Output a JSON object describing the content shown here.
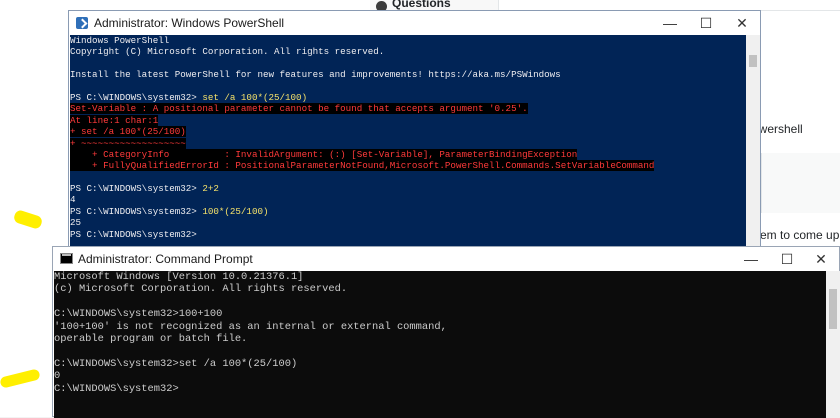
{
  "background": {
    "tab_label": "Questions",
    "right_text_1": "owershell",
    "right_text_2": "em to come up"
  },
  "powershell": {
    "title": "Administrator: Windows PowerShell",
    "controls": {
      "minimize": "—",
      "maximize": "☐",
      "close": "✕"
    },
    "lines": [
      {
        "prompt": "",
        "text": "Windows PowerShell",
        "kind": "normal"
      },
      {
        "prompt": "",
        "text": "Copyright (C) Microsoft Corporation. All rights reserved.",
        "kind": "normal"
      },
      {
        "prompt": "",
        "text": "",
        "kind": "normal"
      },
      {
        "prompt": "",
        "text": "Install the latest PowerShell for new features and improvements! https://aka.ms/PSWindows",
        "kind": "normal"
      },
      {
        "prompt": "",
        "text": "",
        "kind": "normal"
      },
      {
        "prompt": "PS C:\\WINDOWS\\system32> ",
        "text": "set /a 100*(25/100)",
        "kind": "cmd"
      },
      {
        "prompt": "",
        "text": "Set-Variable : A positional parameter cannot be found that accepts argument '0.25'.",
        "kind": "error"
      },
      {
        "prompt": "",
        "text": "At line:1 char:1",
        "kind": "error"
      },
      {
        "prompt": "",
        "text": "+ set /a 100*(25/100)",
        "kind": "error"
      },
      {
        "prompt": "",
        "text": "+ ~~~~~~~~~~~~~~~~~~~",
        "kind": "error"
      },
      {
        "prompt": "",
        "text": "    + CategoryInfo          : InvalidArgument: (:) [Set-Variable], ParameterBindingException",
        "kind": "error"
      },
      {
        "prompt": "",
        "text": "    + FullyQualifiedErrorId : PositionalParameterNotFound,Microsoft.PowerShell.Commands.SetVariableCommand",
        "kind": "error"
      },
      {
        "prompt": "",
        "text": "",
        "kind": "normal"
      },
      {
        "prompt": "PS C:\\WINDOWS\\system32> ",
        "text": "2+2",
        "kind": "cmd"
      },
      {
        "prompt": "",
        "text": "4",
        "kind": "normal"
      },
      {
        "prompt": "PS C:\\WINDOWS\\system32> ",
        "text": "100*(25/100)",
        "kind": "cmd"
      },
      {
        "prompt": "",
        "text": "25",
        "kind": "normal"
      },
      {
        "prompt": "PS C:\\WINDOWS\\system32>",
        "text": "",
        "kind": "cmd"
      }
    ]
  },
  "cmd": {
    "title": "Administrator: Command Prompt",
    "controls": {
      "minimize": "—",
      "maximize": "☐",
      "close": "✕"
    },
    "lines": [
      "Microsoft Windows [Version 10.0.21376.1]",
      "(c) Microsoft Corporation. All rights reserved.",
      "",
      "C:\\WINDOWS\\system32>100+100",
      "'100+100' is not recognized as an internal or external command,",
      "operable program or batch file.",
      "",
      "C:\\WINDOWS\\system32>set /a 100*(25/100)",
      "0",
      "C:\\WINDOWS\\system32>"
    ]
  }
}
